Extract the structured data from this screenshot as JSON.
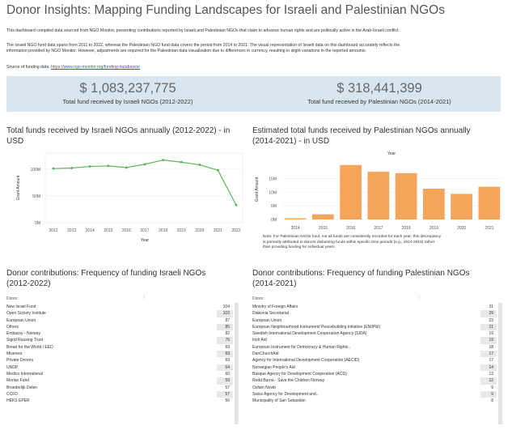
{
  "page": {
    "title": "Donor Insights: Mapping Funding Landscapes for Israeli and Palestinian NGOs",
    "desc1": "This dashboard compiled data sourced from NGO Monitor, presenting contributions reported by Israeli and Palestinian NGOs that claim to advance human rights and are politically active in the Arab-Israeli conflict.",
    "desc2a": "The Israeli NGO fund data spans from 2011 to 2022, whereas the Palestinian NGO fund data covers the period from 2014 to 2021. The visual representation of Israeli data on this dashboard accurately reflects the",
    "desc2b": "information provided by NGO Monitor. However, adjustments are required for the Palestinian data visualization due to differences in currency, resulting in slight variations in the reported amounts.",
    "source_label": "Source of funding data: ",
    "source_link": "https://www.ngo-monitor.org/funding-databases/"
  },
  "kpis": {
    "israeli_value": "$ 1,083,237,775",
    "israeli_label": "Total fund received by Israeli NGOs (2012-2022)",
    "palestinian_value": "$ 318,441,399",
    "palestinian_label": "Total fund received by Palestinian NGOs (2014-2021)"
  },
  "chart_titles": {
    "israeli_line_l1": "Total funds received by Israeli NGOs annually (2012-2022) - in",
    "israeli_line_l2": "USD",
    "pal_bar_l1": "Estimated total funds received by Palestinian NGOs annually",
    "pal_bar_l2": "(2014-2021) - in USD"
  },
  "chart_data": [
    {
      "type": "line",
      "x": [
        "2012",
        "2013",
        "2014",
        "2015",
        "2016",
        "2017",
        "2018",
        "2019",
        "2020",
        "2021",
        "2022"
      ],
      "values": [
        101,
        102,
        105,
        106,
        103,
        109,
        117,
        113,
        108,
        98,
        33
      ],
      "xlabel": "Year",
      "ylabel": "Grant Amount",
      "yticks": [
        "0M",
        "50M",
        "100M"
      ],
      "ylim": [
        0,
        130
      ],
      "color": "#5cb85c",
      "grid": true
    },
    {
      "type": "bar",
      "categories": [
        "2014",
        "2015",
        "2016",
        "2017",
        "2018",
        "2019",
        "2020",
        "2021"
      ],
      "values": [
        0.4,
        1.9,
        20,
        17.5,
        17,
        11.3,
        9.4,
        12
      ],
      "xlabel": "Year",
      "ylabel": "Grant Amount",
      "yticks": [
        "0M",
        "5M",
        "10M",
        "15M"
      ],
      "ylim": [
        0,
        22
      ],
      "color": "#f5a55a",
      "grid": true
    }
  ],
  "note": {
    "l1": "Note: For Palestinian NGOs fund, not all funds are consistently recorded for each year; this discrepancy",
    "l2": "is primarily attributed to donors disbursing funds within specific time periods (e.g., 2014-2015) rather",
    "l3": "than providing funding for individual years."
  },
  "tables": {
    "israeli": {
      "title_l1": "Donor contributions: Frequency of funding Israeli NGOs",
      "title_l2": "(2012-2022)",
      "col_donor": "Donor",
      "sort_icon": "⋮",
      "rows": [
        {
          "name": "New Israel Fund",
          "count": "104"
        },
        {
          "name": "Open Society Institute",
          "count": "102"
        },
        {
          "name": "European Union",
          "count": "87"
        },
        {
          "name": "Others",
          "count": "85"
        },
        {
          "name": "Embassy - Norway",
          "count": "82"
        },
        {
          "name": "Sigrid Rausing Trust",
          "count": "76"
        },
        {
          "name": "Bread for the World / EED",
          "count": "69"
        },
        {
          "name": "Misereor",
          "count": "69"
        },
        {
          "name": "Private Donors",
          "count": "69"
        },
        {
          "name": "UNDP",
          "count": "64"
        },
        {
          "name": "Medico International",
          "count": "60"
        },
        {
          "name": "Morlan Fund",
          "count": "59"
        },
        {
          "name": "Broederlijk Delen",
          "count": "57"
        },
        {
          "name": "CCFD",
          "count": "57"
        },
        {
          "name": "HEKS EPER",
          "count": "56"
        }
      ]
    },
    "palestinian": {
      "title_l1": "Donor contributions: Frequency of funding Palestinian NGOs",
      "title_l2": "(2014-2021)",
      "col_donor": "Donor",
      "sort_icon": "⋮",
      "rows": [
        {
          "name": "Ministry of Foreign Affairs",
          "count": "31"
        },
        {
          "name": "Diakonia Secretariat",
          "count": "29"
        },
        {
          "name": "European Union",
          "count": "23"
        },
        {
          "name": "European Neighbourhood Instrument/ Peacebuilding Initiative (ENI/PbI)",
          "count": "21"
        },
        {
          "name": "Swedish International Development Cooperation Agency (SIDA)",
          "count": "19"
        },
        {
          "name": "Irish Aid",
          "count": "19"
        },
        {
          "name": "European Instrument for Democracy & Human Rights..",
          "count": "18"
        },
        {
          "name": "DanChurchAid",
          "count": "17"
        },
        {
          "name": "Agency for International Development Cooperation (AECID)",
          "count": "17"
        },
        {
          "name": "Norwegian People's Aid",
          "count": "14"
        },
        {
          "name": "Basque Agency for Development Cooperation (ACD)",
          "count": "13"
        },
        {
          "name": "Redd Barna - Save the Children Norway",
          "count": "12"
        },
        {
          "name": "Oxfam Novib",
          "count": "9"
        },
        {
          "name": "Swiss Agency for Development and..",
          "count": "9"
        },
        {
          "name": "Municipality of San Sebastián",
          "count": "8"
        }
      ]
    }
  }
}
